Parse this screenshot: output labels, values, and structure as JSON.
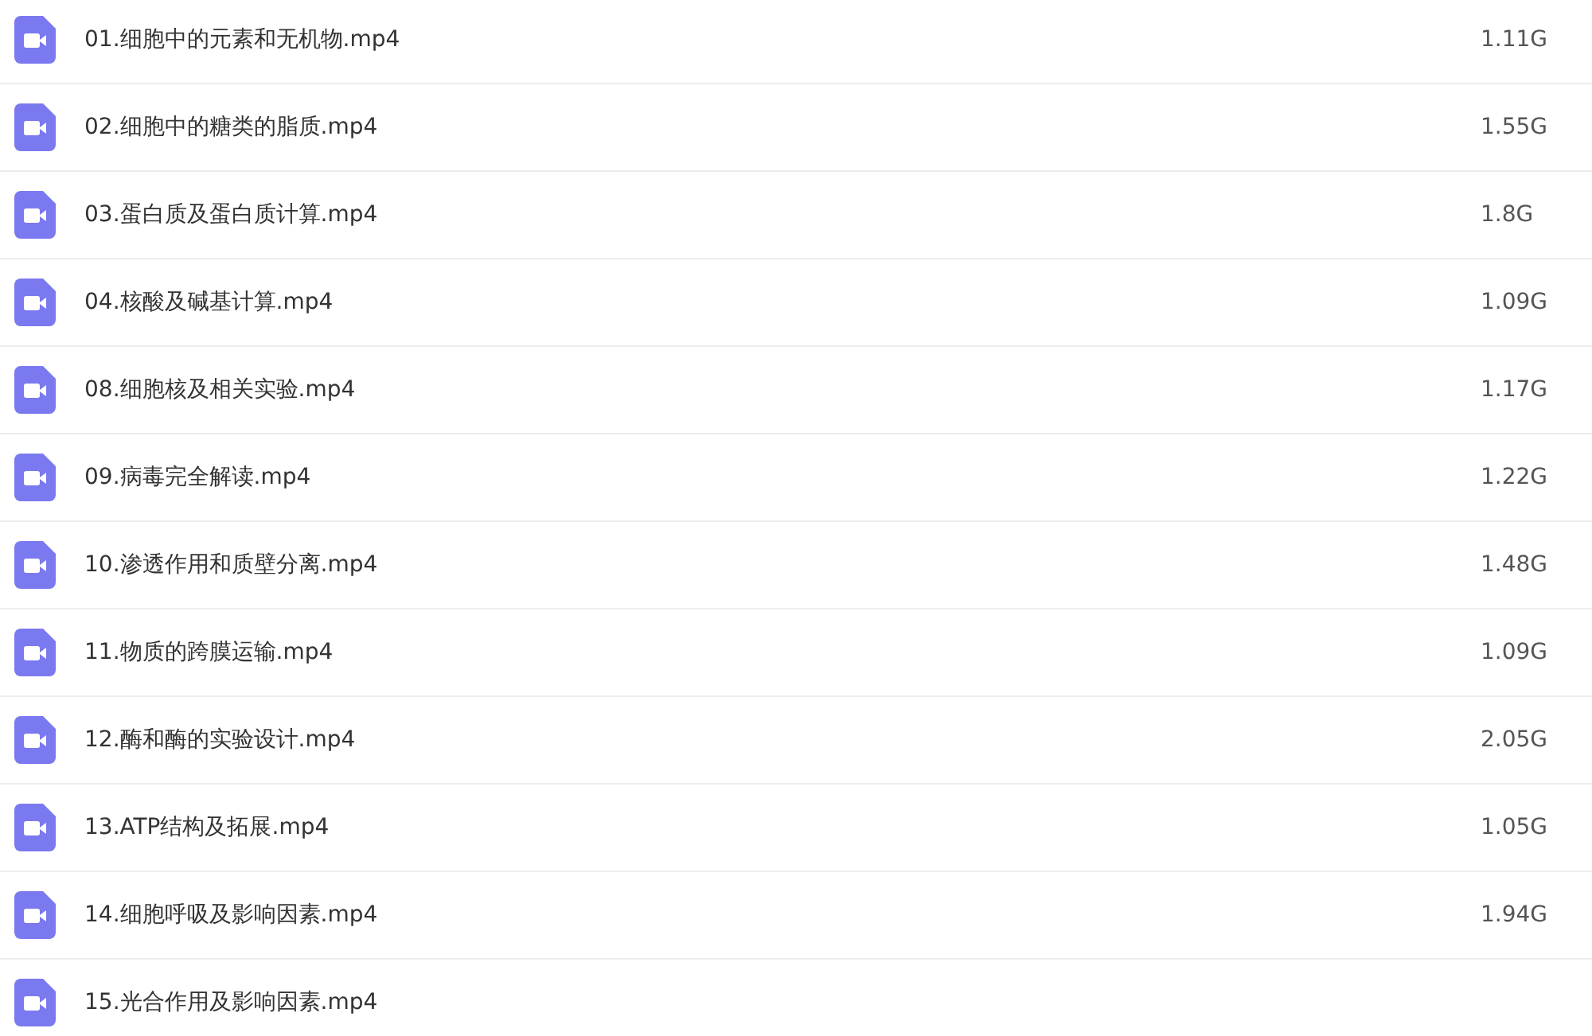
{
  "files": [
    {
      "name": "01.细胞中的元素和无机物.mp4",
      "size": "1.11G"
    },
    {
      "name": "02.细胞中的糖类的脂质.mp4",
      "size": "1.55G"
    },
    {
      "name": "03.蛋白质及蛋白质计算.mp4",
      "size": "1.8G"
    },
    {
      "name": "04.核酸及碱基计算.mp4",
      "size": "1.09G"
    },
    {
      "name": "08.细胞核及相关实验.mp4",
      "size": "1.17G"
    },
    {
      "name": "09.病毒完全解读.mp4",
      "size": "1.22G"
    },
    {
      "name": "10.渗透作用和质壁分离.mp4",
      "size": "1.48G"
    },
    {
      "name": "11.物质的跨膜运输.mp4",
      "size": "1.09G"
    },
    {
      "name": "12.酶和酶的实验设计.mp4",
      "size": "2.05G"
    },
    {
      "name": "13.ATP结构及拓展.mp4",
      "size": "1.05G"
    },
    {
      "name": "14.细胞呼吸及影响因素.mp4",
      "size": "1.94G"
    },
    {
      "name": "15.光合作用及影响因素.mp4"
    }
  ]
}
